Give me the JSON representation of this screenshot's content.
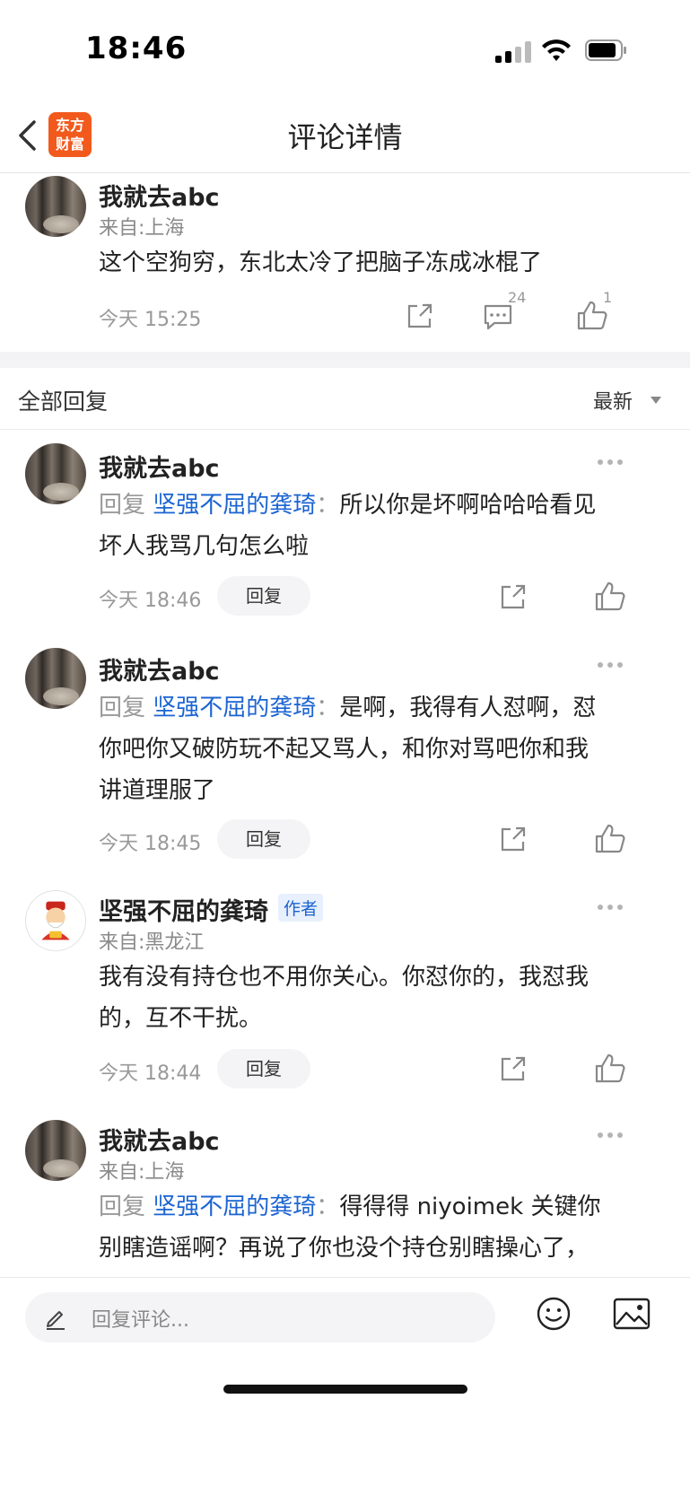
{
  "status": {
    "time": "18:46"
  },
  "header": {
    "logo_line1": "东方",
    "logo_line2": "财富",
    "title": "评论详情"
  },
  "main_comment": {
    "name": "我就去abc",
    "location": "来自:上海",
    "text": "这个空狗穷，东北太冷了把脑子冻成冰棍了",
    "time": "今天 15:25",
    "comment_count": "24",
    "like_count": "1"
  },
  "replies_header": {
    "title": "全部回复",
    "sort": "最新"
  },
  "replies": [
    {
      "name": "我就去abc",
      "reply_prefix": "回复",
      "mention": "坚强不屈的龚琦",
      "colon": "：",
      "line1": "所以你是坏啊哈哈哈看见",
      "line2": "坏人我骂几句怎么啦",
      "time": "今天 18:46",
      "reply_label": "回复"
    },
    {
      "name": "我就去abc",
      "reply_prefix": "回复",
      "mention": "坚强不屈的龚琦",
      "colon": "：",
      "line1": "是啊，我得有人怼啊，怼",
      "line2": "你吧你又破防玩不起又骂人，和你对骂吧你和我",
      "line3": "讲道理服了",
      "time": "今天 18:45",
      "reply_label": "回复"
    },
    {
      "name": "坚强不屈的龚琦",
      "author_tag": "作者",
      "location": "来自:黑龙江",
      "line1": "我有没有持仓也不用你关心。你怼你的，我怼我",
      "line2": "的，互不干扰。",
      "time": "今天 18:44",
      "reply_label": "回复"
    },
    {
      "name": "我就去abc",
      "location": "来自:上海",
      "reply_prefix": "回复",
      "mention": "坚强不屈的龚琦",
      "colon": "：",
      "line1": "得得得 niyoimek 关键你",
      "line2": "别瞎造谣啊？再说了你也没个持仓别瞎操心了，"
    }
  ],
  "bottom": {
    "placeholder": "回复评论..."
  },
  "colors": {
    "brand": "#f25a1d",
    "link": "#1b64d2",
    "muted": "#999999"
  }
}
